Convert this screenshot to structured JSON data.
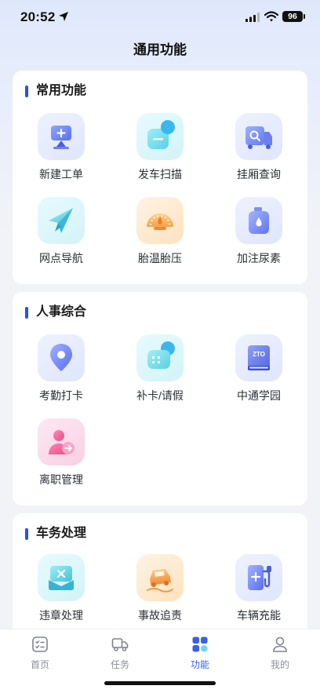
{
  "status_bar": {
    "time": "20:52",
    "battery": "96"
  },
  "page": {
    "title": "通用功能"
  },
  "sections": [
    {
      "title": "常用功能",
      "items": [
        {
          "label": "新建工单",
          "icon": "monitor-plus-icon"
        },
        {
          "label": "发车扫描",
          "icon": "scan-icon"
        },
        {
          "label": "挂厢查询",
          "icon": "trailer-search-icon"
        },
        {
          "label": "网点导航",
          "icon": "paper-plane-icon"
        },
        {
          "label": "胎温胎压",
          "icon": "gauge-icon"
        },
        {
          "label": "加注尿素",
          "icon": "fluid-can-icon"
        }
      ]
    },
    {
      "title": "人事综合",
      "items": [
        {
          "label": "考勤打卡",
          "icon": "location-pin-icon"
        },
        {
          "label": "补卡/请假",
          "icon": "chat-bubble-icon"
        },
        {
          "label": "中通学园",
          "icon": "book-icon",
          "badge_text": "ZTO"
        },
        {
          "label": "离职管理",
          "icon": "user-leave-icon"
        }
      ]
    },
    {
      "title": "车务处理",
      "items": [
        {
          "label": "违章处理",
          "icon": "violation-ticket-icon"
        },
        {
          "label": "事故追责",
          "icon": "car-accident-icon"
        },
        {
          "label": "车辆充能",
          "icon": "charging-station-icon"
        }
      ]
    }
  ],
  "tab_bar": {
    "tabs": [
      {
        "label": "首页",
        "icon": "home-list-icon",
        "active": false
      },
      {
        "label": "任务",
        "icon": "truck-icon",
        "active": false
      },
      {
        "label": "功能",
        "icon": "apps-grid-icon",
        "active": true
      },
      {
        "label": "我的",
        "icon": "person-icon",
        "active": false
      }
    ]
  },
  "colors": {
    "accent": "#3561f0",
    "section_bar": "#2b52e0"
  }
}
